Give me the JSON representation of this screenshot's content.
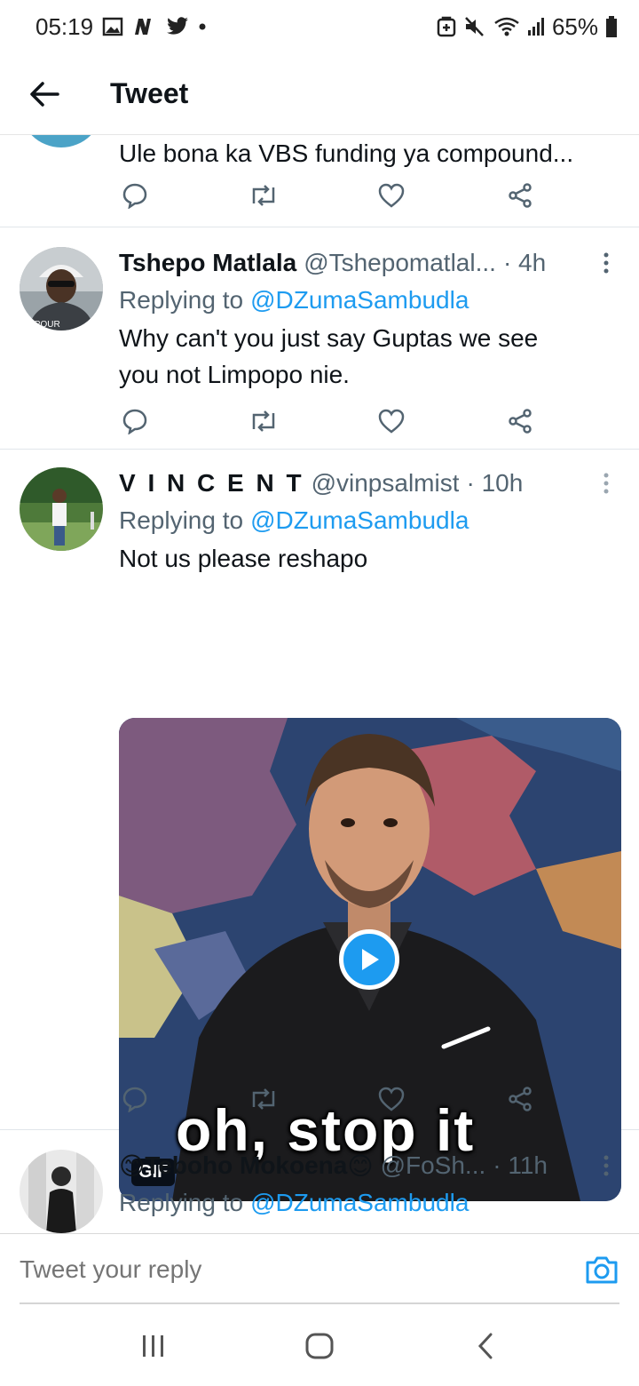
{
  "status_bar": {
    "time": "05:19",
    "battery": "65%",
    "left_icons": [
      "gallery-icon",
      "news-icon",
      "twitter-icon",
      "dot-icon"
    ],
    "right_icons": [
      "vpn-icon",
      "mute-icon",
      "wifi-icon",
      "signal-icon",
      "battery-icon"
    ]
  },
  "header": {
    "title": "Tweet"
  },
  "tweets": [
    {
      "text": "Ule bona ka VBS funding ya compound..."
    },
    {
      "name": "Tshepo Matlala",
      "handle": "@Tshepomatlal...",
      "time": "· 4h",
      "replying_label": "Replying to",
      "replying_to": "@DZumaSambudla",
      "text_line1": "Why can't you just say Guptas we see",
      "text_line2": "you not Limpopo nie.",
      "avatar_text": "IPOUR"
    },
    {
      "name": "V I N C E N T",
      "handle": "@vinpsalmist",
      "time": "· 10h",
      "replying_label": "Replying to",
      "replying_to": "@DZumaSambudla",
      "text": "Not us please reshapo",
      "media": {
        "caption": "oh, stop it",
        "badge": "GIF"
      }
    },
    {
      "name_emoji_left": "😊",
      "name": "Teboho Mokoena",
      "name_emoji_right": "😊",
      "handle": "@FoSh...",
      "time": "· 11h",
      "replying_label": "Replying to",
      "replying_to": "@DZumaSambudla"
    }
  ],
  "composer": {
    "placeholder": "Tweet your reply"
  },
  "colors": {
    "link": "#1d9bf0",
    "secondary_text": "#536471",
    "divider": "#e1e6ea"
  }
}
